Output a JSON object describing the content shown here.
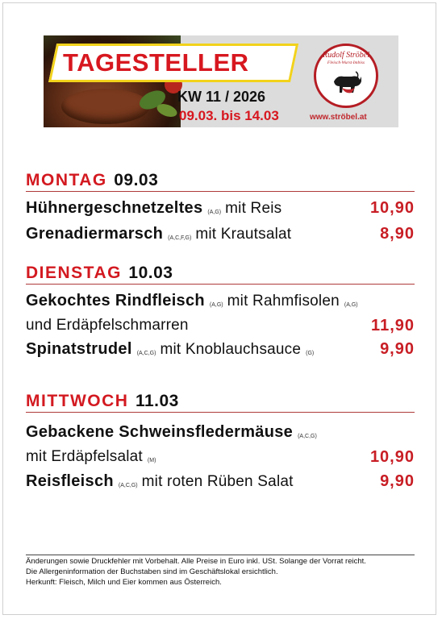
{
  "banner": {
    "title": "TAGESTELLER",
    "week": "KW 11 / 2026",
    "dates": "09.03. bis 14.03",
    "logo_name": "Rudolf Ströbel",
    "logo_sub": "Fleisch·Wurst·Imbiss",
    "website": "www.ströbel.at",
    "colors": {
      "accent_red": "#d7171f",
      "frame_yellow": "#f2d21b"
    }
  },
  "days": [
    {
      "name": "MONTAG",
      "date": "09.03",
      "lines": [
        {
          "dish": "Hühnergeschnetzeltes",
          "allergens": "(A,G)",
          "rest": "mit Reis",
          "price": "10,90"
        },
        {
          "dish": "Grenadiermarsch",
          "allergens": "(A,C,F,G)",
          "rest": "mit Krautsalat",
          "price": "8,90"
        }
      ]
    },
    {
      "name": "DIENSTAG",
      "date": "10.03",
      "lines": [
        {
          "dish": "Gekochtes Rindfleisch",
          "allergens": "(A,G)",
          "rest": "mit Rahmfisolen",
          "allergens2": "(A,G)"
        },
        {
          "rest": "und Erdäpfelschmarren",
          "price": "11,90"
        },
        {
          "dish": "Spinatstrudel",
          "allergens": "(A,C,G)",
          "rest": "mit Knoblauchsauce",
          "allergens2": "(G)",
          "price": "9,90"
        }
      ]
    },
    {
      "name": "MITTWOCH",
      "date": "11.03",
      "lines": [
        {
          "dish": "Gebackene Schweinsfledermäuse",
          "allergens": "(A,C,G)"
        },
        {
          "rest": "mit Erdäpfelsalat",
          "allergens2": "(M)",
          "price": "10,90"
        },
        {
          "dish": "Reisfleisch",
          "allergens": "(A,C,G)",
          "rest": "mit roten Rüben Salat",
          "price": "9,90"
        }
      ]
    }
  ],
  "footer": {
    "line1": "Änderungen sowie Druckfehler mit Vorbehalt. Alle Preise in Euro inkl. USt. Solange der Vorrat reicht.",
    "line2": "Die Allergeninformation der Buchstaben sind im Geschäftslokal ersichtlich.",
    "line3": "Herkunft: Fleisch, Milch und Eier kommen aus Österreich."
  }
}
